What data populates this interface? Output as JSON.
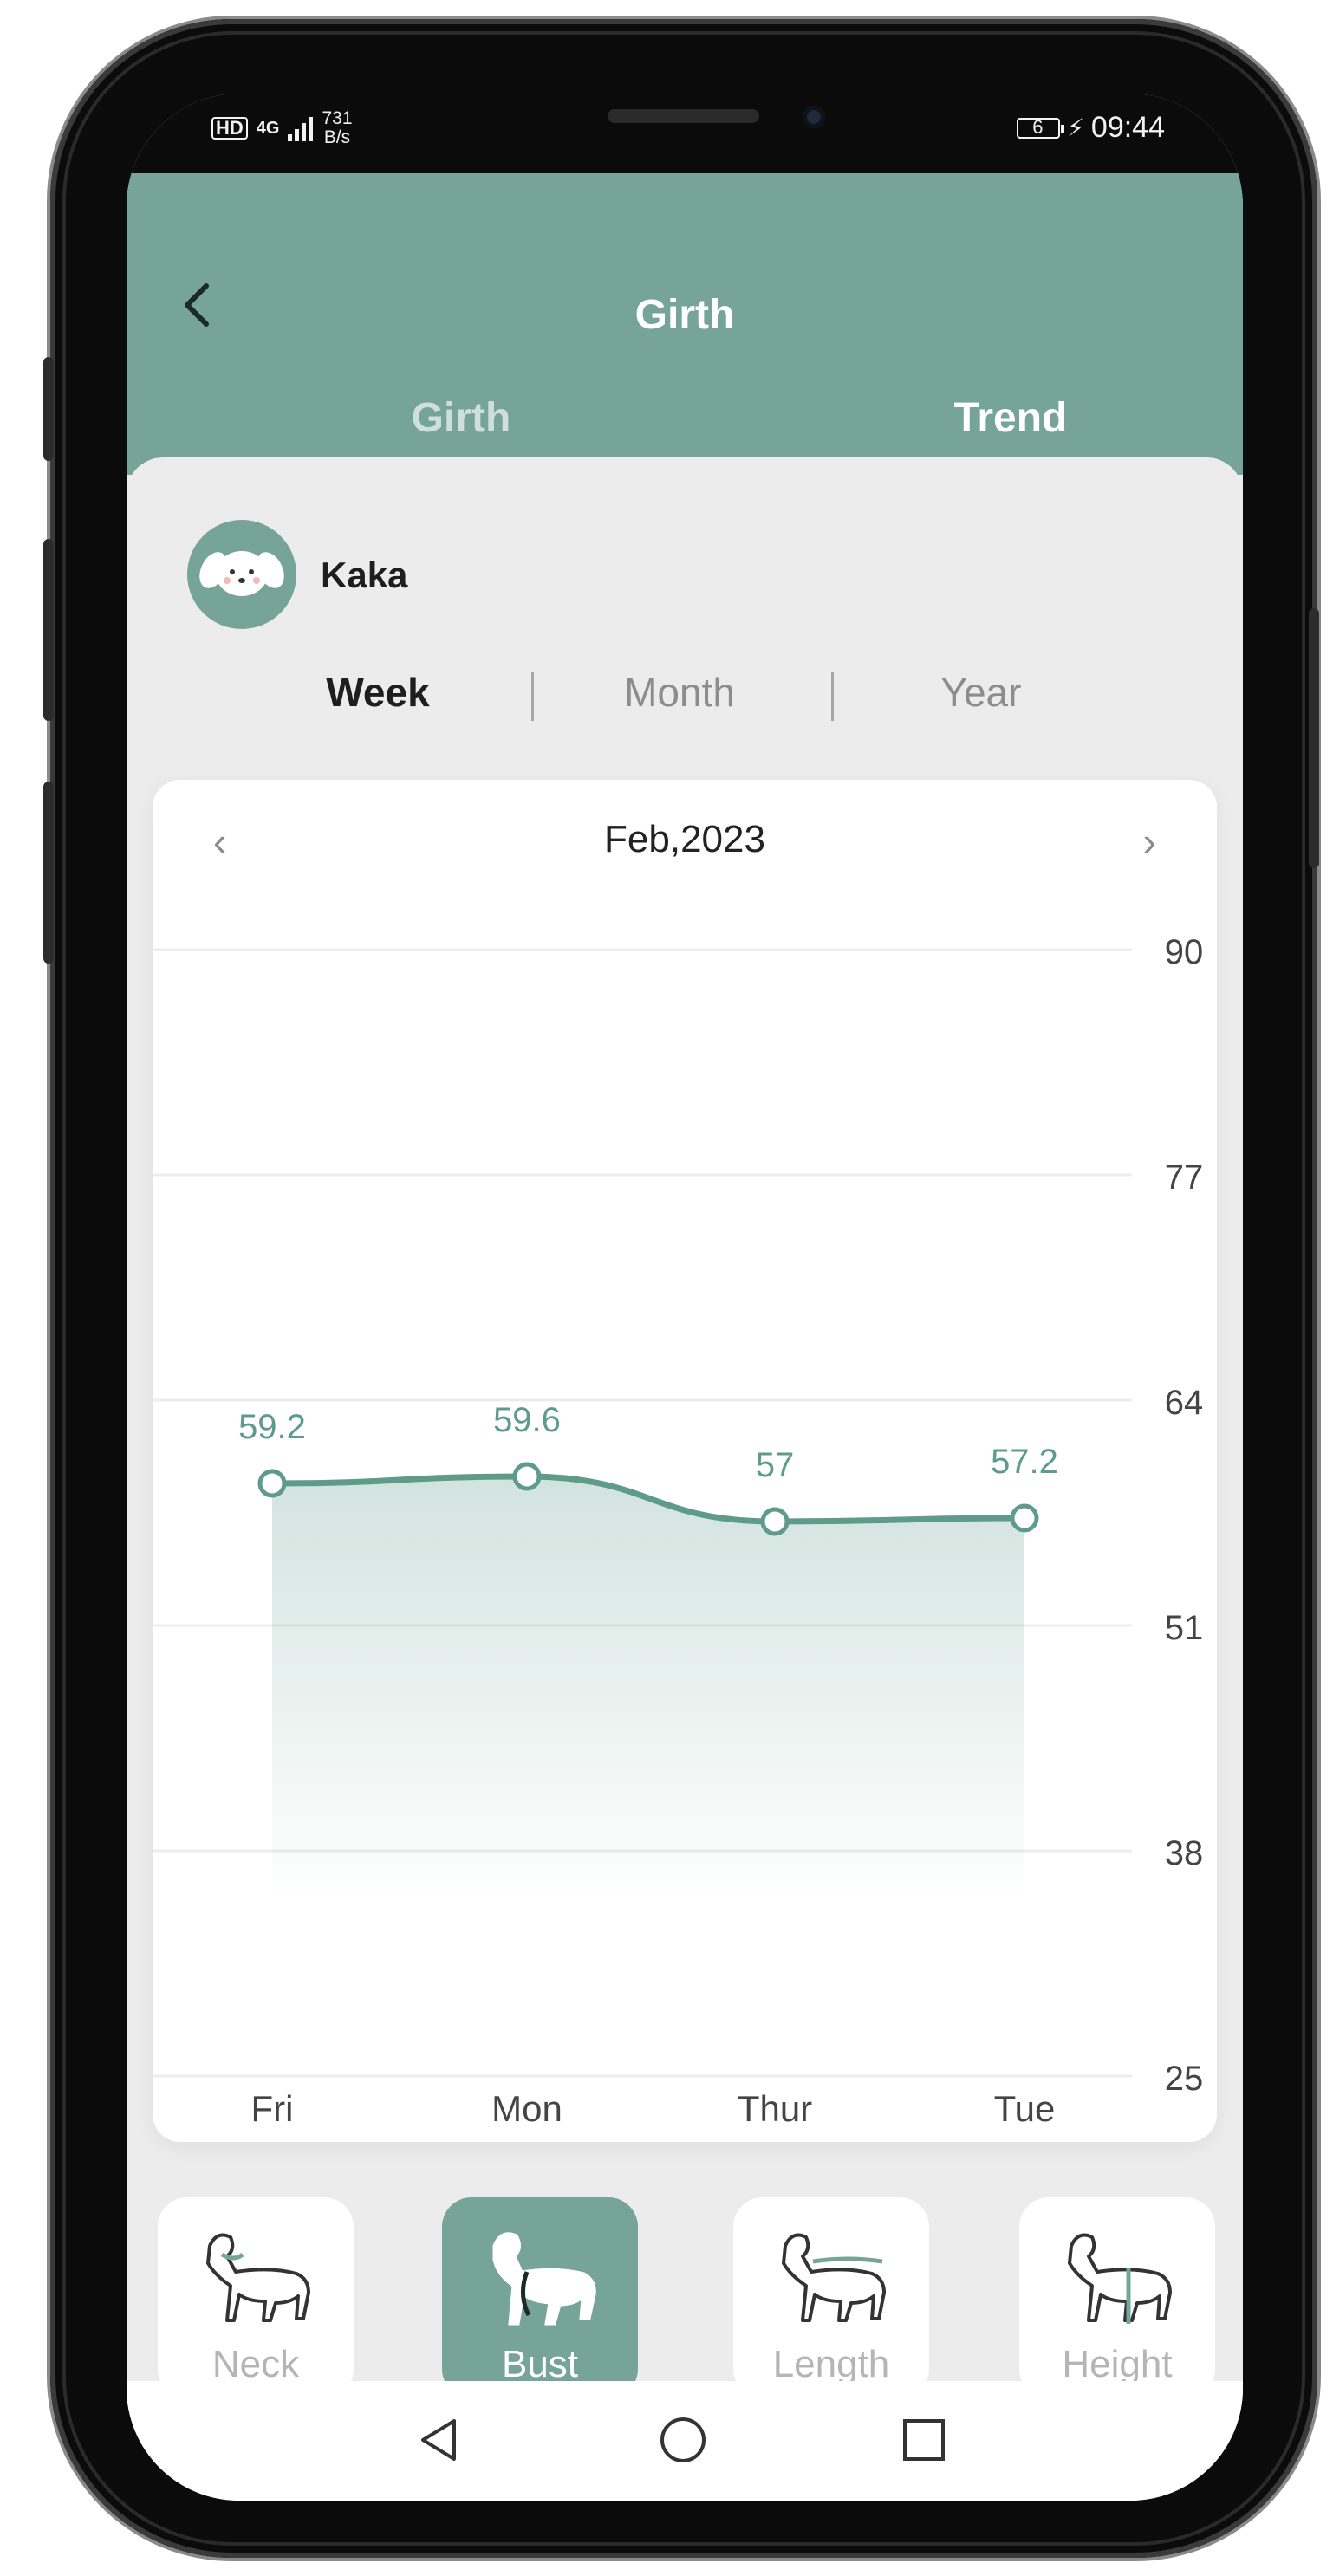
{
  "status_bar": {
    "hd": "HD",
    "network": "4G",
    "speed_value": "731",
    "speed_unit": "B/s",
    "time": "09:44",
    "battery_level": "6"
  },
  "header": {
    "title": "Girth",
    "tabs": [
      {
        "label": "Girth",
        "active": false
      },
      {
        "label": "Trend",
        "active": true
      }
    ]
  },
  "pet": {
    "name": "Kaka"
  },
  "period_tabs": [
    {
      "label": "Week",
      "active": true
    },
    {
      "label": "Month",
      "active": false
    },
    {
      "label": "Year",
      "active": false
    }
  ],
  "chart_nav": {
    "month_label": "Feb,2023",
    "prev": "‹",
    "next": "›"
  },
  "chart_data": {
    "type": "area",
    "categories": [
      "Fri",
      "Mon",
      "Thur",
      "Tue"
    ],
    "values": [
      59.2,
      59.6,
      57,
      57.2
    ],
    "data_labels": [
      "59.2",
      "59.6",
      "57",
      "57.2"
    ],
    "y_ticks": [
      90,
      77,
      64,
      51,
      38,
      25
    ],
    "ylim": [
      25,
      90
    ],
    "y_axis_position": "right",
    "grid": true,
    "line_color": "#5f9b8b"
  },
  "measurements": [
    {
      "label": "Neck",
      "icon": "dog-neck-icon",
      "active": false
    },
    {
      "label": "Bust",
      "icon": "dog-bust-icon",
      "active": true
    },
    {
      "label": "Length",
      "icon": "dog-length-icon",
      "active": false
    },
    {
      "label": "Height",
      "icon": "dog-height-icon",
      "active": false
    }
  ],
  "colors": {
    "accent": "#76a598",
    "accent_line": "#5f9b8b",
    "background": "#ececec"
  }
}
